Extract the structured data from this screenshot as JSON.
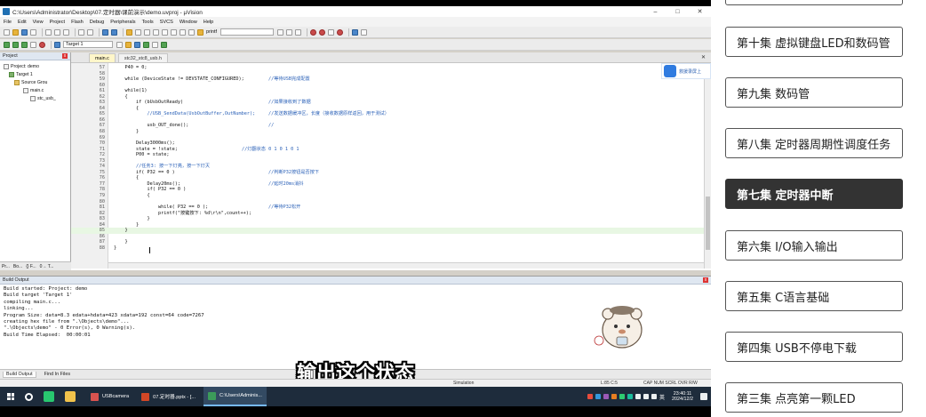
{
  "window": {
    "title": "C:\\Users\\Administrator\\Desktop\\07.定时器\\课前演示\\demo.uvproj - µVision",
    "controls": [
      "–",
      "□",
      "✕"
    ]
  },
  "menu": [
    "File",
    "Edit",
    "View",
    "Project",
    "Flash",
    "Debug",
    "Peripherals",
    "Tools",
    "SVCS",
    "Window",
    "Help"
  ],
  "toolbar": {
    "function_combo": "printf",
    "target_combo": "Target 1"
  },
  "project_panel": {
    "title": "Project",
    "close": "x",
    "tree": [
      "Project: demo",
      "Target 1",
      "Source Grou",
      "main.c",
      "stc_usb_"
    ],
    "tabs": [
      "Pr...",
      "Bo...",
      "{} F...",
      "0→ T..."
    ]
  },
  "editor": {
    "tabs": [
      "main.c",
      "stc32_stc8_usb.h"
    ],
    "lines": [
      {
        "n": "57",
        "code": "    P40 = 0;",
        "comment": ""
      },
      {
        "n": "58",
        "code": "",
        "comment": ""
      },
      {
        "n": "59",
        "code": "    while (DeviceState != DEVSTATE_CONFIGURED);",
        "comment": "//等待USB完成配置"
      },
      {
        "n": "60",
        "code": "",
        "comment": ""
      },
      {
        "n": "61",
        "code": "    while(1)",
        "comment": ""
      },
      {
        "n": "62",
        "code": "    {",
        "comment": ""
      },
      {
        "n": "63",
        "code": "        if (bUsbOutReady)",
        "comment": "//如果接收到了数据"
      },
      {
        "n": "64",
        "code": "        {",
        "comment": ""
      },
      {
        "n": "65",
        "code": "            //USB_SendData(UsbOutBuffer,OutNumber);",
        "comment": "//发送数据缓冲区，长度（接收数据原样返回，用于测试）"
      },
      {
        "n": "66",
        "code": "",
        "comment": ""
      },
      {
        "n": "67",
        "code": "            usb_OUT_done();",
        "comment": "//"
      },
      {
        "n": "68",
        "code": "        }",
        "comment": ""
      },
      {
        "n": "69",
        "code": "",
        "comment": ""
      },
      {
        "n": "70",
        "code": "        Delay3000ms();",
        "comment": ""
      },
      {
        "n": "71",
        "code": "        state = !state;",
        "comment": "//灯翻状态 0 1 0 1 0 1"
      },
      {
        "n": "72",
        "code": "        P00 = state;",
        "comment": ""
      },
      {
        "n": "73",
        "code": "",
        "comment": ""
      },
      {
        "n": "74",
        "code": "        //任务3: 按一下灯亮，按一下灯灭",
        "comment": ""
      },
      {
        "n": "75",
        "code": "        if( P32 == 0 )",
        "comment": "//判断P32按钮是否按下"
      },
      {
        "n": "76",
        "code": "        {",
        "comment": ""
      },
      {
        "n": "77",
        "code": "            Delay20ms();",
        "comment": "//延时20ms消抖"
      },
      {
        "n": "78",
        "code": "            if( P32 == 0 )",
        "comment": ""
      },
      {
        "n": "79",
        "code": "            {",
        "comment": ""
      },
      {
        "n": "80",
        "code": "",
        "comment": ""
      },
      {
        "n": "81",
        "code": "                while( P32 == 0 );",
        "comment": "//等待P32松开"
      },
      {
        "n": "82",
        "code": "                printf(\"按键按下: %d\\r\\n\",count++);",
        "comment": ""
      },
      {
        "n": "83",
        "code": "            }",
        "comment": ""
      },
      {
        "n": "84",
        "code": "        }",
        "comment": ""
      },
      {
        "n": "85",
        "code": "    }",
        "comment": ""
      },
      {
        "n": "86",
        "code": "",
        "comment": ""
      },
      {
        "n": "87",
        "code": "    }",
        "comment": ""
      },
      {
        "n": "88",
        "code": "}",
        "comment": ""
      }
    ],
    "overlay_label": "救援录屏上"
  },
  "build_output": {
    "title": "Build Output",
    "text": "Build started: Project: demo\nBuild target 'Target 1'\ncompiling main.c...\nlinking...\nProgram Size: data=8.3 edata+hdata=423 xdata=192 const=64 code=7267\ncreating hex file from \".\\Objects\\demo\"...\n\".\\Objects\\demo\" - 0 Error(s), 0 Warning(s).\nBuild Time Elapsed:  00:00:01",
    "tabs": [
      "Build Output",
      "Find In Files"
    ]
  },
  "status_bar": {
    "mode": "Simulation",
    "position": "L:85 C:5",
    "flags": "CAP  NUM  SCRL  OVR  R/W"
  },
  "subtitle": "输出这个状态",
  "taskbar": {
    "apps": [
      "USBcamera",
      "07.定时器.pptx - [...",
      "C:\\Users\\Adminis..."
    ],
    "time": "23:40:11",
    "date": "2024/12/2",
    "ime": "英"
  },
  "episodes": [
    {
      "label": "第十集 虚拟键盘LED和数码管",
      "active": false
    },
    {
      "label": "第九集 数码管",
      "active": false
    },
    {
      "label": "第八集 定时器周期性调度任务",
      "active": false
    },
    {
      "label": "第七集 定时器中断",
      "active": true
    },
    {
      "label": "第六集 I/O输入输出",
      "active": false
    },
    {
      "label": "第五集 C语言基础",
      "active": false
    },
    {
      "label": "第四集 USB不停电下载",
      "active": false
    },
    {
      "label": "第三集 点亮第一颗LED",
      "active": false
    }
  ],
  "colors": {
    "active_episode_bg": "#333333",
    "comment": "#2c62b8",
    "highlight_line": "#e8f7e3",
    "taskbar": "#1e2c3c"
  }
}
